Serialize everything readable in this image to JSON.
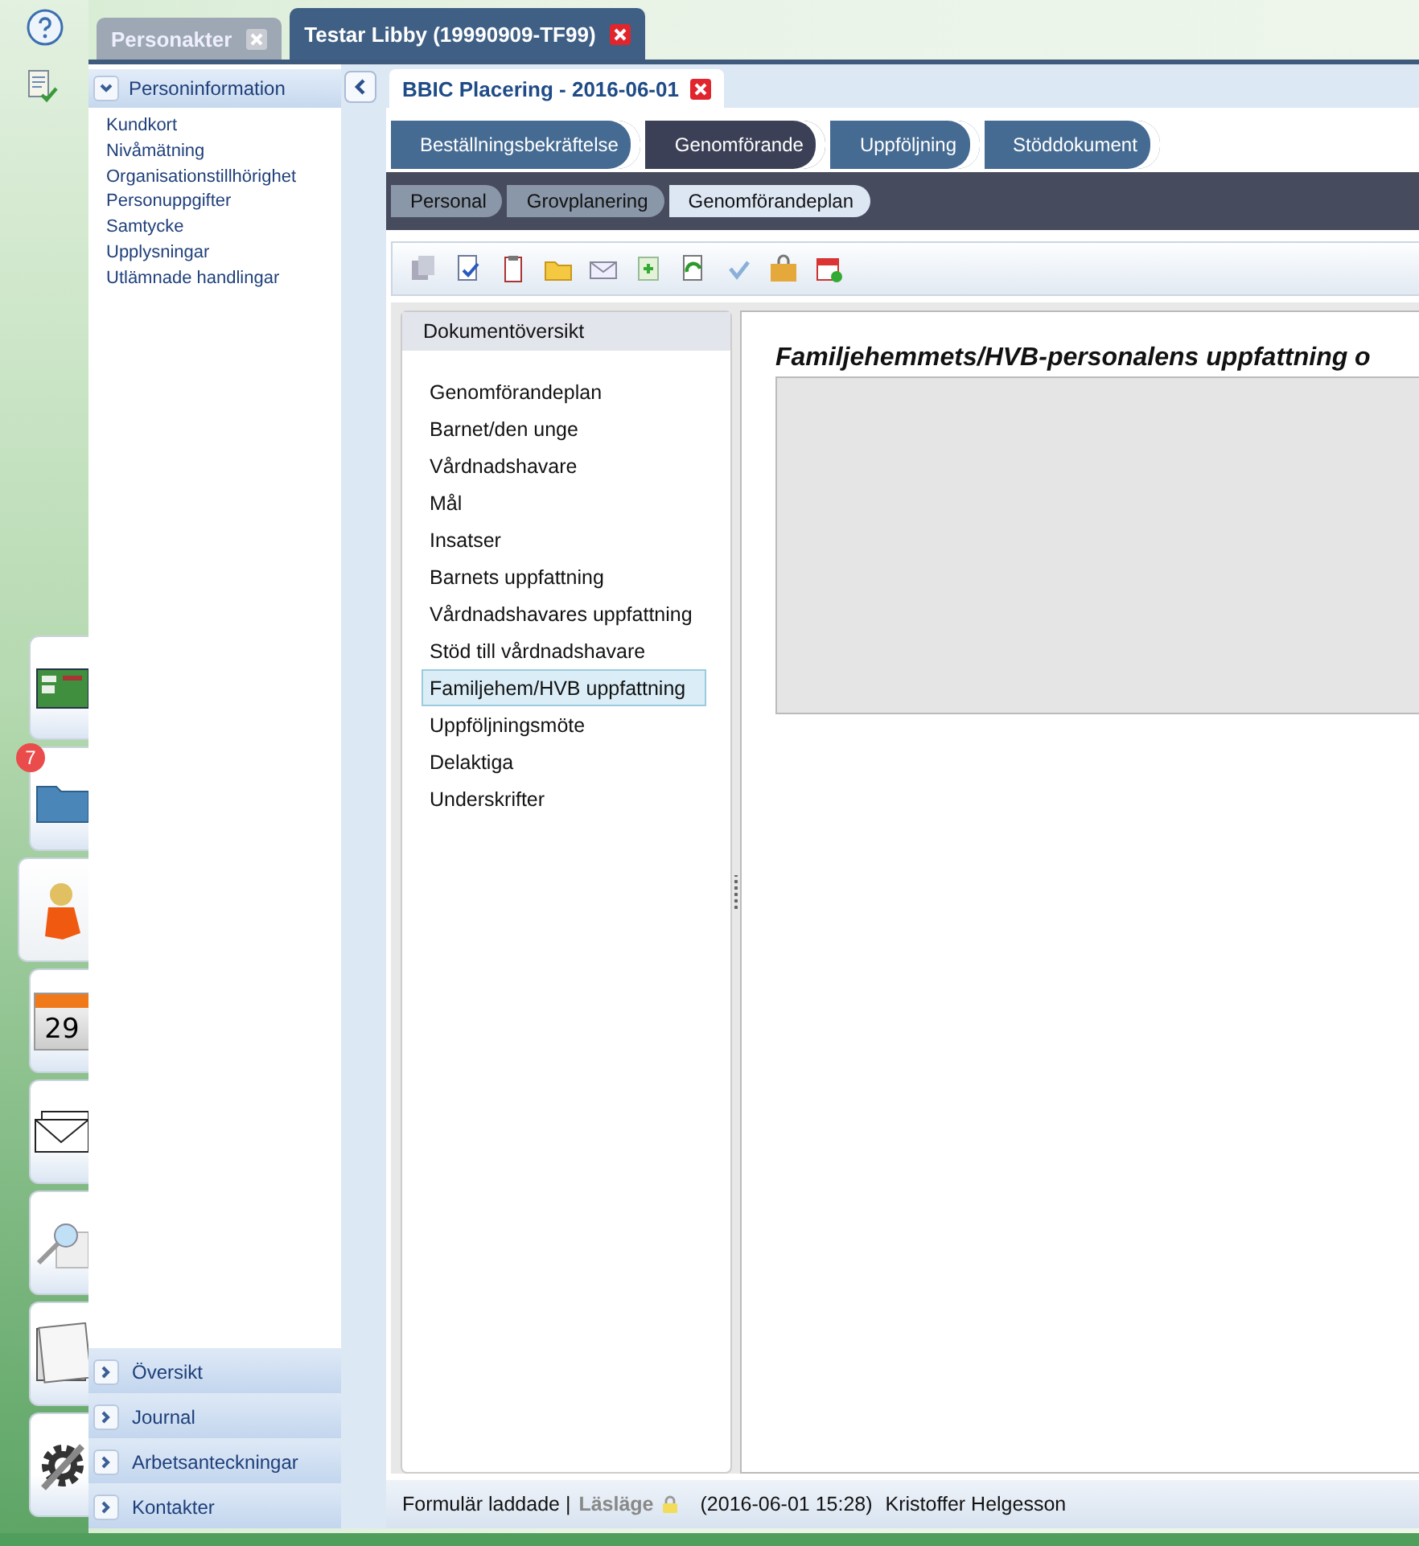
{
  "window_tabs": [
    {
      "label": "Personakter",
      "selected": false
    },
    {
      "label": "Testar Libby (19990909-TF99)",
      "selected": true
    }
  ],
  "launcher": [
    {
      "kind": "screen",
      "selected": false
    },
    {
      "kind": "folder",
      "selected": false,
      "badge": "7"
    },
    {
      "kind": "person",
      "selected": true
    },
    {
      "kind": "calendar",
      "selected": false,
      "day": "29"
    },
    {
      "kind": "mail",
      "selected": false
    },
    {
      "kind": "search",
      "selected": false
    },
    {
      "kind": "papers",
      "selected": false
    },
    {
      "kind": "tools",
      "selected": false
    }
  ],
  "sidebar": {
    "title": "Personinformation",
    "expanded": true,
    "items": [
      "Kundkort",
      "Nivåmätning",
      "Organisationstillhörighet",
      "Personuppgifter",
      "Samtycke",
      "Upplysningar",
      "Utlämnade handlingar"
    ],
    "sections": [
      {
        "label": "Översikt",
        "expanded": false
      },
      {
        "label": "Journal",
        "expanded": false
      },
      {
        "label": "Arbetsanteckningar",
        "expanded": false
      },
      {
        "label": "Kontakter",
        "expanded": false
      }
    ]
  },
  "document_tab": {
    "label": "BBIC Placering - 2016-06-01"
  },
  "steps": [
    {
      "label": "Beställningsbekräftelse",
      "selected": false
    },
    {
      "label": "Genomförande",
      "selected": true
    },
    {
      "label": "Uppföljning",
      "selected": false
    },
    {
      "label": "Stöddokument",
      "selected": false
    }
  ],
  "substeps": [
    {
      "label": "Personal",
      "selected": false
    },
    {
      "label": "Grovplanering",
      "selected": false
    },
    {
      "label": "Genomförandeplan",
      "selected": true
    }
  ],
  "overview": {
    "title": "Dokumentöversikt",
    "items": [
      {
        "label": "Genomförandeplan",
        "selected": false
      },
      {
        "label": "Barnet/den unge",
        "selected": false
      },
      {
        "label": "Vårdnadshavare",
        "selected": false
      },
      {
        "label": "Mål",
        "selected": false
      },
      {
        "label": "Insatser",
        "selected": false
      },
      {
        "label": "Barnets uppfattning",
        "selected": false
      },
      {
        "label": "Vårdnadshavares uppfattning",
        "selected": false
      },
      {
        "label": "Stöd till vårdnadshavare",
        "selected": false
      },
      {
        "label": "Familjehem/HVB uppfattning",
        "selected": true
      },
      {
        "label": "Uppföljningsmöte",
        "selected": false
      },
      {
        "label": "Delaktiga",
        "selected": false
      },
      {
        "label": "Underskrifter",
        "selected": false
      }
    ]
  },
  "content": {
    "heading": "Familjehemmets/HVB-personalens uppfattning o"
  },
  "status_bar": {
    "status": "Formulär laddade |",
    "mode": "Läsläge",
    "timestamp": "(2016-06-01 15:28)",
    "user": "Kristoffer Helgesson"
  }
}
